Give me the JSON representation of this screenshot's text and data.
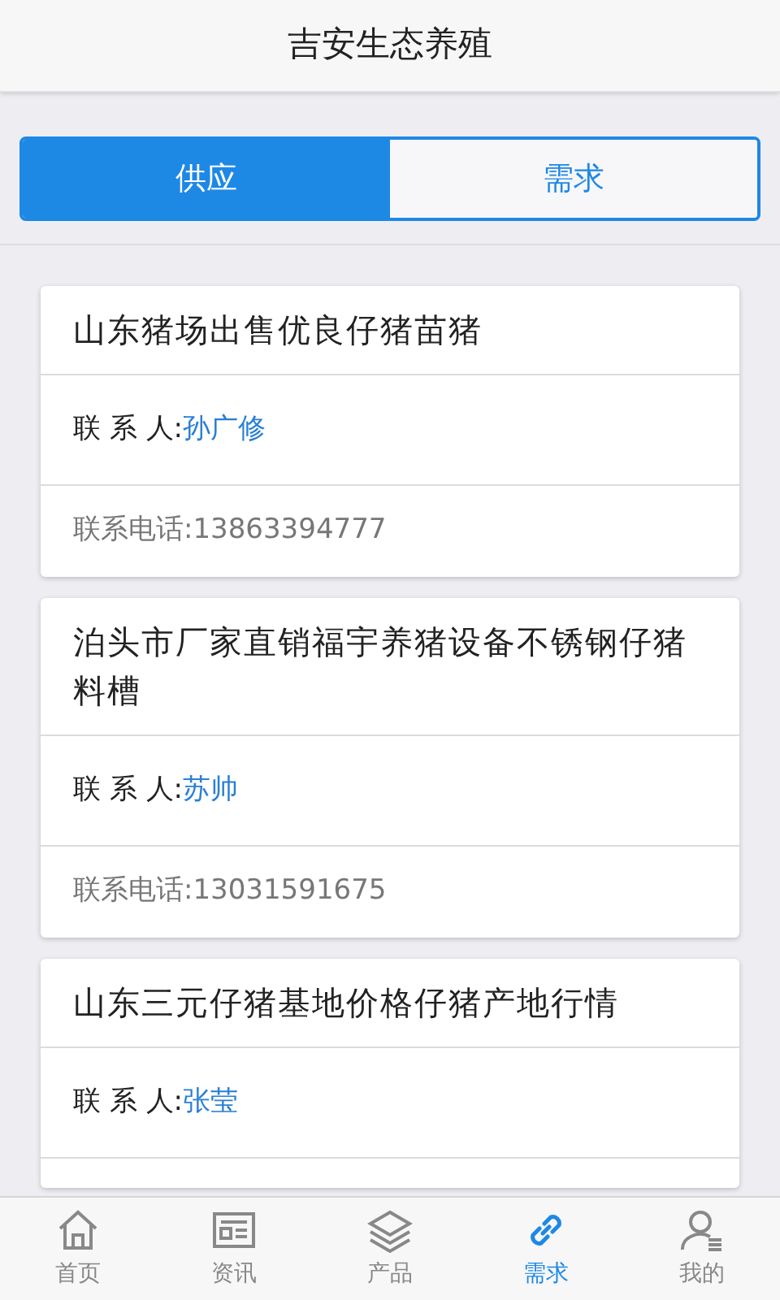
{
  "header": {
    "title": "吉安生态养殖"
  },
  "segments": [
    {
      "label": "供应",
      "selected": true
    },
    {
      "label": "需求",
      "selected": false
    }
  ],
  "listings": [
    {
      "title": "山东猪场出售优良仔猪苗猪",
      "contact_label": "联 系 人:",
      "contact": "孙广修",
      "phone": "联系电话:13863394777"
    },
    {
      "title": "泊头市厂家直销福宇养猪设备不锈钢仔猪料槽",
      "contact_label": "联 系 人:",
      "contact": "苏帅",
      "phone": "联系电话:13031591675"
    },
    {
      "title": "山东三元仔猪基地价格仔猪产地行情",
      "contact_label": "联 系 人:",
      "contact": "张莹"
    }
  ],
  "nav": [
    {
      "label": "首页",
      "kind": "home",
      "selected": false
    },
    {
      "label": "资讯",
      "kind": "news",
      "selected": false
    },
    {
      "label": "产品",
      "kind": "layers",
      "selected": false
    },
    {
      "label": "需求",
      "kind": "link",
      "selected": true
    },
    {
      "label": "我的",
      "kind": "user",
      "selected": false
    }
  ]
}
